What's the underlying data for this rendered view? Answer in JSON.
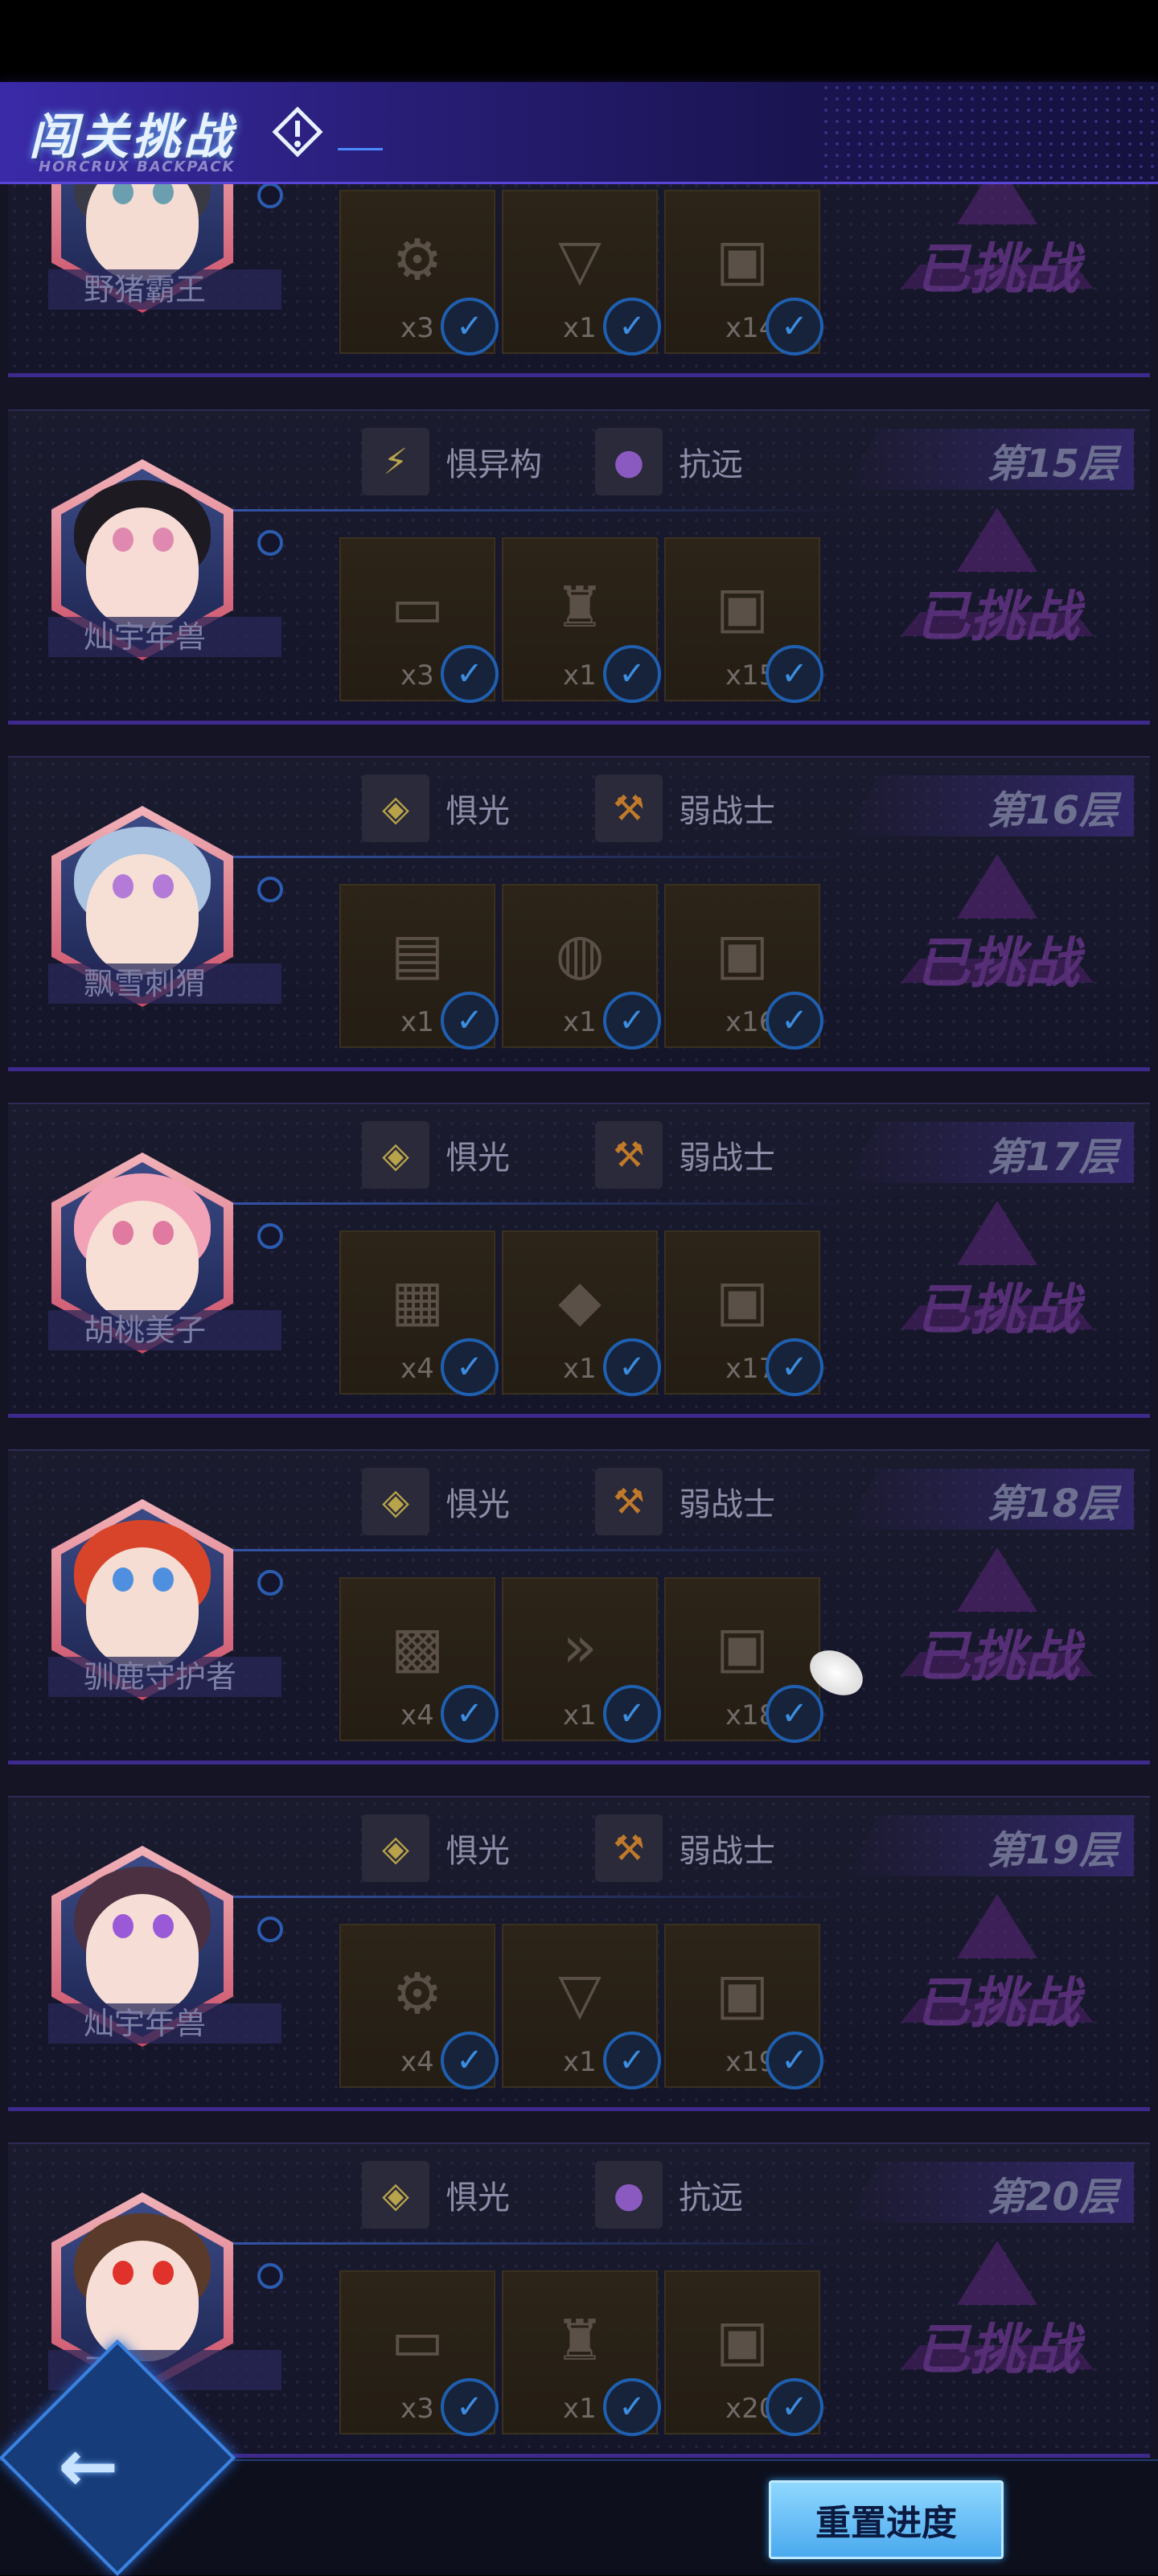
{
  "header": {
    "title": "闯关挑战",
    "subtitle": "HORCRUX BACKPACK"
  },
  "colors": {
    "accent": "#5b45d9",
    "challenged": "#a24bd0",
    "check": "#3c8de0"
  },
  "floors": [
    {
      "floor_label": "",
      "challenged": "已挑战",
      "avatar_name": "野猪霸王",
      "traits": [],
      "items": [
        {
          "icon": "mech-parts-icon",
          "glyph": "⚙",
          "qty": "x3"
        },
        {
          "icon": "core-device-icon",
          "glyph": "▽",
          "qty": "x1"
        },
        {
          "icon": "chip-cube-icon",
          "glyph": "▣",
          "qty": "x140"
        }
      ]
    },
    {
      "floor_label": "第15层",
      "challenged": "已挑战",
      "avatar_name": "灿宇年兽",
      "traits": [
        {
          "icon": "slash-icon",
          "glyph": "⚡",
          "name": "惧异构"
        },
        {
          "icon": "grape-icon",
          "glyph": "●",
          "name": "抗远"
        }
      ],
      "items": [
        {
          "icon": "ticket-icon",
          "glyph": "▭",
          "qty": "x3"
        },
        {
          "icon": "chef-hat-icon",
          "glyph": "♜",
          "qty": "x1"
        },
        {
          "icon": "chip-cube-icon",
          "glyph": "▣",
          "qty": "x150"
        }
      ]
    },
    {
      "floor_label": "第16层",
      "challenged": "已挑战",
      "avatar_name": "飘雪刺猬",
      "traits": [
        {
          "icon": "light-diamond-icon",
          "glyph": "◈",
          "name": "惧光"
        },
        {
          "icon": "hammer-icon",
          "glyph": "⚒",
          "name": "弱战士"
        }
      ],
      "items": [
        {
          "icon": "device-icon",
          "glyph": "▤",
          "qty": "x1"
        },
        {
          "icon": "food-plate-icon",
          "glyph": "◍",
          "qty": "x1"
        },
        {
          "icon": "chip-cube-icon",
          "glyph": "▣",
          "qty": "x160"
        }
      ]
    },
    {
      "floor_label": "第17层",
      "challenged": "已挑战",
      "avatar_name": "胡桃美子",
      "traits": [
        {
          "icon": "light-diamond-icon",
          "glyph": "◈",
          "name": "惧光"
        },
        {
          "icon": "hammer-icon",
          "glyph": "⚒",
          "name": "弱战士"
        }
      ],
      "items": [
        {
          "icon": "chest-icon",
          "glyph": "▦",
          "qty": "x4"
        },
        {
          "icon": "gold-card-icon",
          "glyph": "◆",
          "qty": "x1"
        },
        {
          "icon": "chip-cube-icon",
          "glyph": "▣",
          "qty": "x170"
        }
      ]
    },
    {
      "floor_label": "第18层",
      "challenged": "已挑战",
      "avatar_name": "驯鹿守护者",
      "traits": [
        {
          "icon": "light-diamond-icon",
          "glyph": "◈",
          "name": "惧光"
        },
        {
          "icon": "hammer-icon",
          "glyph": "⚒",
          "name": "弱战士"
        }
      ],
      "items": [
        {
          "icon": "crate-icon",
          "glyph": "▩",
          "qty": "x4"
        },
        {
          "icon": "book-icon",
          "glyph": "»",
          "qty": "x1"
        },
        {
          "icon": "chip-cube-icon",
          "glyph": "▣",
          "qty": "x180"
        }
      ]
    },
    {
      "floor_label": "第19层",
      "challenged": "已挑战",
      "avatar_name": "灿宇年兽",
      "traits": [
        {
          "icon": "light-diamond-icon",
          "glyph": "◈",
          "name": "惧光"
        },
        {
          "icon": "hammer-icon",
          "glyph": "⚒",
          "name": "弱战士"
        }
      ],
      "items": [
        {
          "icon": "mech-parts-icon",
          "glyph": "⚙",
          "qty": "x4"
        },
        {
          "icon": "core-device-icon",
          "glyph": "▽",
          "qty": "x1"
        },
        {
          "icon": "chip-cube-icon",
          "glyph": "▣",
          "qty": "x190"
        }
      ]
    },
    {
      "floor_label": "第20层",
      "challenged": "已挑战",
      "avatar_name": "王",
      "traits": [
        {
          "icon": "light-diamond-icon",
          "glyph": "◈",
          "name": "惧光"
        },
        {
          "icon": "grape-icon",
          "glyph": "●",
          "name": "抗远"
        }
      ],
      "items": [
        {
          "icon": "ticket-icon",
          "glyph": "▭",
          "qty": "x3"
        },
        {
          "icon": "chef-hat-icon",
          "glyph": "♜",
          "qty": "x1"
        },
        {
          "icon": "chip-cube-icon",
          "glyph": "▣",
          "qty": "x200"
        }
      ]
    }
  ],
  "footer": {
    "back_icon": "back-arrow-icon",
    "back_glyph": "←",
    "reset_label": "重置进度"
  }
}
